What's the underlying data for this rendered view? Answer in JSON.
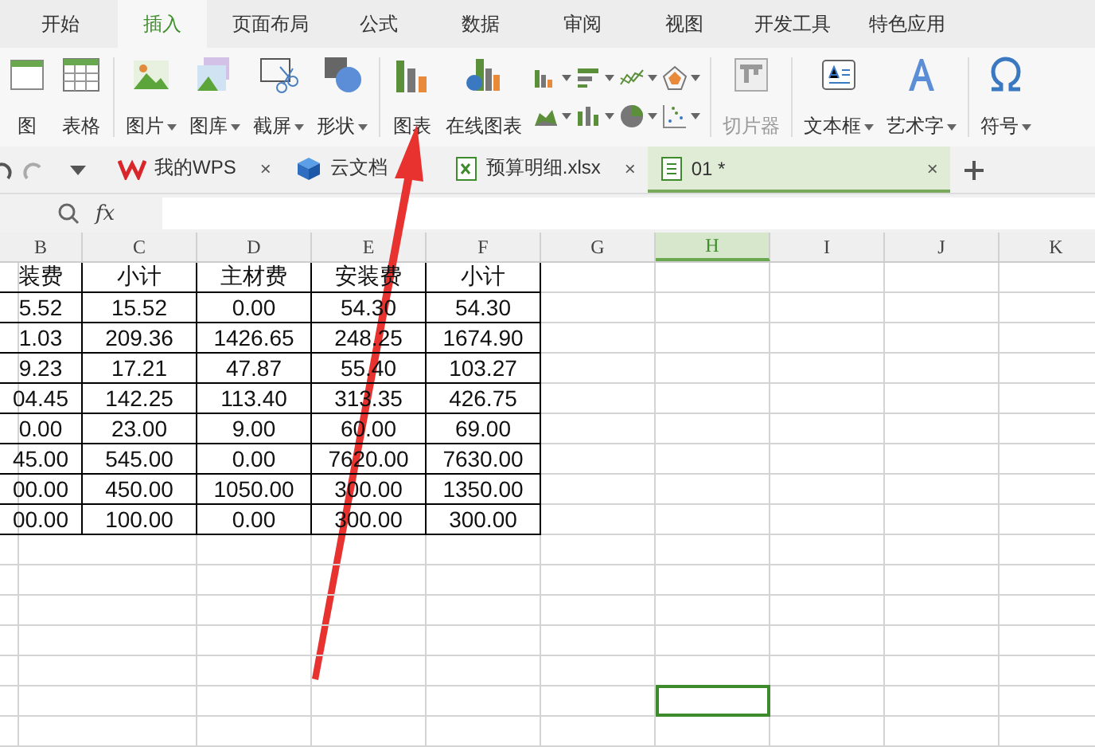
{
  "ribbon_tabs": [
    {
      "label": "开始",
      "selected": false
    },
    {
      "label": "插入",
      "selected": true
    },
    {
      "label": "页面布局",
      "selected": false
    },
    {
      "label": "公式",
      "selected": false
    },
    {
      "label": "数据",
      "selected": false
    },
    {
      "label": "审阅",
      "selected": false
    },
    {
      "label": "视图",
      "selected": false
    },
    {
      "label": "开发工具",
      "selected": false
    },
    {
      "label": "特色应用",
      "selected": false
    }
  ],
  "ribbon": [
    {
      "kind": "large",
      "label": "图",
      "dropdown": false,
      "disabled": false
    },
    {
      "kind": "large",
      "label": "表格",
      "dropdown": false,
      "disabled": false
    },
    {
      "kind": "separator"
    },
    {
      "kind": "large",
      "label": "图片",
      "dropdown": true,
      "disabled": false
    },
    {
      "kind": "large",
      "label": "图库",
      "dropdown": true,
      "disabled": false
    },
    {
      "kind": "large",
      "label": "截屏",
      "dropdown": true,
      "disabled": false
    },
    {
      "kind": "large",
      "label": "形状",
      "dropdown": true,
      "disabled": false
    },
    {
      "kind": "separator"
    },
    {
      "kind": "large",
      "label": "图表",
      "dropdown": false,
      "disabled": false
    },
    {
      "kind": "large",
      "label": "在线图表",
      "dropdown": false,
      "disabled": false
    },
    {
      "kind": "chart-grid"
    },
    {
      "kind": "separator"
    },
    {
      "kind": "large",
      "label": "切片器",
      "dropdown": false,
      "disabled": true
    },
    {
      "kind": "separator"
    },
    {
      "kind": "large",
      "label": "文本框",
      "dropdown": true,
      "disabled": false
    },
    {
      "kind": "large",
      "label": "艺术字",
      "dropdown": true,
      "disabled": false
    },
    {
      "kind": "separator"
    },
    {
      "kind": "large",
      "label": "符号",
      "dropdown": true,
      "disabled": false
    }
  ],
  "doc_tabs": [
    {
      "label": "我的WPS",
      "close": "×",
      "selected": false
    },
    {
      "label": "云文档",
      "selected": false
    },
    {
      "label": "预算明细.xlsx",
      "close": "×",
      "selected": false
    },
    {
      "label": "01 *",
      "close": "×",
      "selected": true
    }
  ],
  "formula_bar": {
    "function_label": "fx"
  },
  "columns": [
    {
      "label": "B",
      "selected": false
    },
    {
      "label": "C",
      "selected": false
    },
    {
      "label": "D",
      "selected": false
    },
    {
      "label": "E",
      "selected": false
    },
    {
      "label": "F",
      "selected": false
    },
    {
      "label": "G",
      "selected": false
    },
    {
      "label": "H",
      "selected": true
    },
    {
      "label": "I",
      "selected": false
    },
    {
      "label": "J",
      "selected": false
    },
    {
      "label": "K",
      "selected": false
    }
  ],
  "table_rows": [
    [
      "装费",
      "小计",
      "主材费",
      "安装费",
      "小计"
    ],
    [
      "5.52",
      "15.52",
      "0.00",
      "54.30",
      "54.30"
    ],
    [
      "1.03",
      "209.36",
      "1426.65",
      "248.25",
      "1674.90"
    ],
    [
      "9.23",
      "17.21",
      "47.87",
      "55.40",
      "103.27"
    ],
    [
      "04.45",
      "142.25",
      "113.40",
      "313.35",
      "426.75"
    ],
    [
      "0.00",
      "23.00",
      "9.00",
      "60.00",
      "69.00"
    ],
    [
      "45.00",
      "545.00",
      "0.00",
      "7620.00",
      "7630.00"
    ],
    [
      "00.00",
      "450.00",
      "1050.00",
      "300.00",
      "1350.00"
    ],
    [
      "00.00",
      "100.00",
      "0.00",
      "300.00",
      "300.00"
    ]
  ],
  "blank_rows": [
    {
      "selected": false
    },
    {
      "selected": false
    },
    {
      "selected": false
    },
    {
      "selected": false
    },
    {
      "selected": false
    },
    {
      "selected": true
    },
    {
      "selected": false
    }
  ]
}
